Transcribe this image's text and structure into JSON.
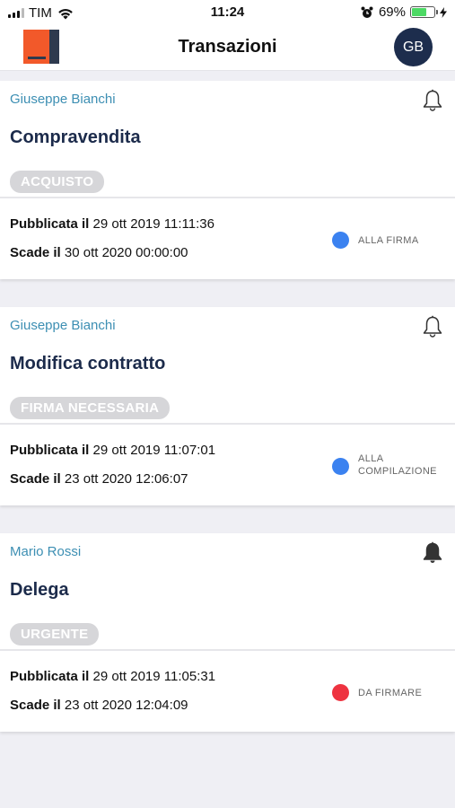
{
  "status_bar": {
    "carrier": "TIM",
    "time": "11:24",
    "battery": "69%",
    "battery_level": 0.69
  },
  "header": {
    "title": "Transazioni",
    "avatar_initials": "GB"
  },
  "transactions": [
    {
      "author": "Giuseppe Bianchi",
      "title": "Compravendita",
      "tag": "ACQUISTO",
      "published_label": "Pubblicata il",
      "published_value": "29 ott 2019 11:11:36",
      "expires_label": "Scade il",
      "expires_value": "30 ott 2020 00:00:00",
      "status_lines": [
        "ALLA FIRMA"
      ],
      "status_color": "#3b82f0",
      "bell": "bell-outline-icon"
    },
    {
      "author": "Giuseppe Bianchi",
      "title": "Modifica contratto",
      "tag": "FIRMA NECESSARIA",
      "published_label": "Pubblicata il",
      "published_value": "29 ott 2019 11:07:01",
      "expires_label": "Scade il",
      "expires_value": "23 ott 2020 12:06:07",
      "status_lines": [
        "ALLA",
        "COMPILAZIONE"
      ],
      "status_color": "#3b82f0",
      "bell": "bell-outline-icon"
    },
    {
      "author": "Mario Rossi",
      "title": "Delega",
      "tag": "URGENTE",
      "published_label": "Pubblicata il",
      "published_value": "29 ott 2019 11:05:31",
      "expires_label": "Scade il",
      "expires_value": "23 ott 2020 12:04:09",
      "status_lines": [
        "DA FIRMARE"
      ],
      "status_color": "#ee3340",
      "bell": "bell-filled-icon"
    }
  ]
}
